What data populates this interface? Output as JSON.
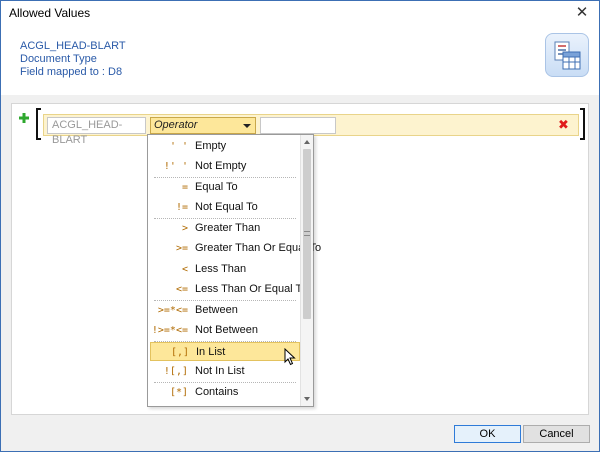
{
  "window": {
    "title": "Allowed Values",
    "close_glyph": "✕"
  },
  "header": {
    "field_name": "ACGL_HEAD-BLART",
    "description": "Document Type",
    "mapping": "Field mapped to : D8",
    "icon": "list-grid-icon"
  },
  "condition": {
    "field": "ACGL_HEAD-BLART",
    "operator_placeholder": "Operator",
    "value": "",
    "add_icon": "plus-icon",
    "remove_glyph": "✖"
  },
  "operators": [
    {
      "symbol": "' '",
      "label": "Empty"
    },
    {
      "symbol": "!' '",
      "label": "Not Empty"
    },
    {
      "symbol": "=",
      "label": "Equal To"
    },
    {
      "symbol": "!=",
      "label": "Not Equal To"
    },
    {
      "symbol": ">",
      "label": "Greater Than"
    },
    {
      "symbol": ">=",
      "label": "Greater Than Or Equal To"
    },
    {
      "symbol": "<",
      "label": "Less Than"
    },
    {
      "symbol": "<=",
      "label": "Less Than Or Equal To"
    },
    {
      "symbol": ">=*<=",
      "label": "Between"
    },
    {
      "symbol": "!>=*<=",
      "label": "Not Between"
    },
    {
      "symbol": "[,]",
      "label": "In List"
    },
    {
      "symbol": "![,]",
      "label": "Not In List"
    },
    {
      "symbol": "[*]",
      "label": "Contains"
    }
  ],
  "selected_operator": "In List",
  "buttons": {
    "ok": "OK",
    "cancel": "Cancel"
  },
  "colors": {
    "row_highlight": "#fdf3cf",
    "selected_item": "#fde79a",
    "header_text": "#2a5aa8",
    "remove": "#e01b1b",
    "add": "#2ea82e"
  }
}
